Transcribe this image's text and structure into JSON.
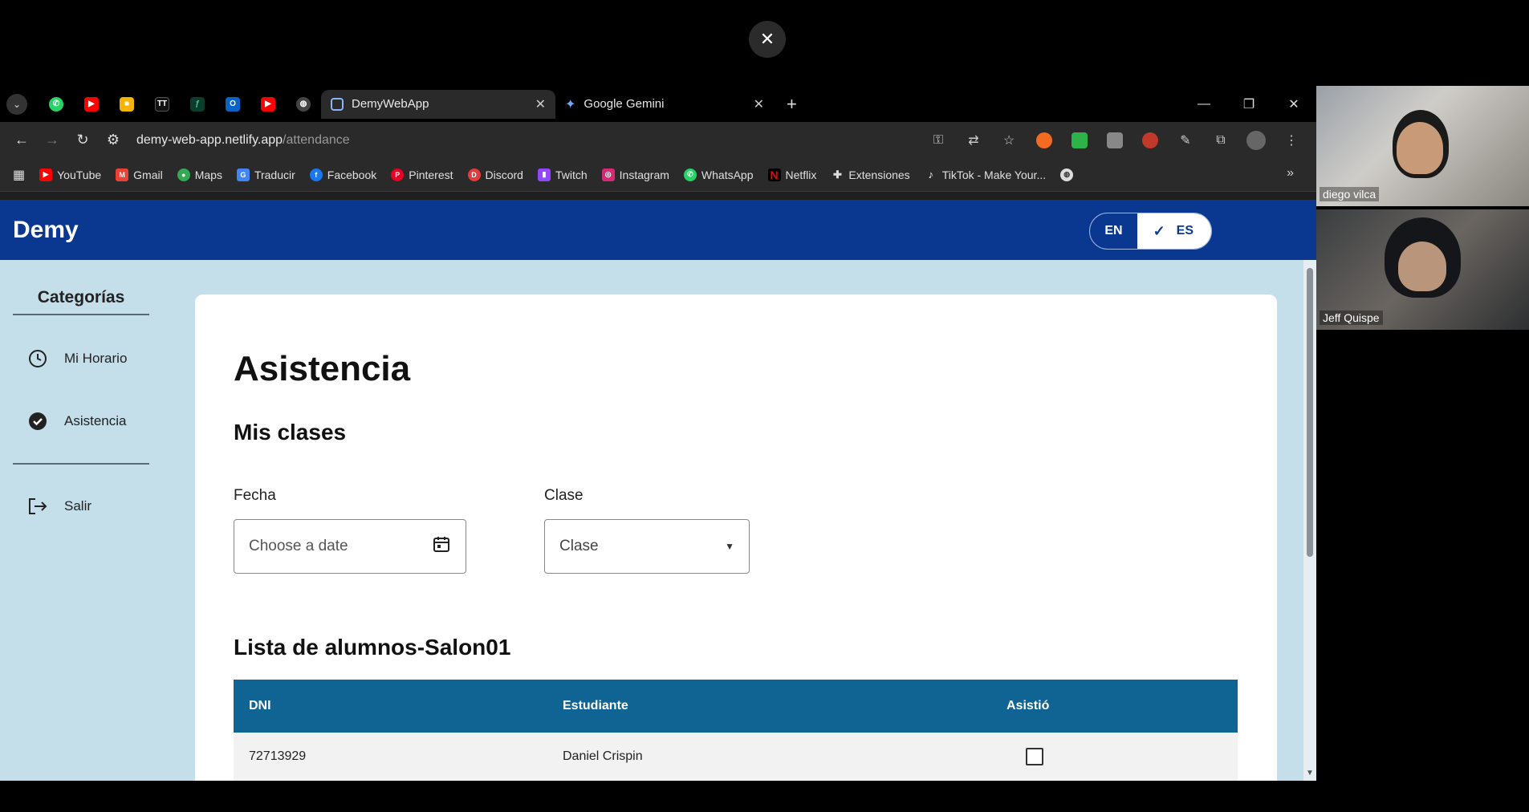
{
  "overlay": {
    "close_icon": "close-icon"
  },
  "browser": {
    "tabs": [
      {
        "label": "DemyWebApp",
        "active": true
      },
      {
        "label": "Google Gemini",
        "active": false
      }
    ],
    "url": {
      "host": "demy-web-app.netlify.app",
      "path": "/attendance"
    },
    "bookmarks": [
      "YouTube",
      "Gmail",
      "Maps",
      "Traducir",
      "Facebook",
      "Pinterest",
      "Discord",
      "Twitch",
      "Instagram",
      "WhatsApp",
      "Netflix",
      "Extensiones",
      "TikTok - Make Your..."
    ]
  },
  "app": {
    "brand": "Demy",
    "lang": {
      "en": "EN",
      "es": "ES",
      "selected": "ES"
    },
    "sidebar": {
      "title": "Categorías",
      "items": [
        {
          "label": "Mi Horario",
          "icon": "clock-icon"
        },
        {
          "label": "Asistencia",
          "icon": "check-circle-icon"
        },
        {
          "label": "Salir",
          "icon": "logout-icon"
        }
      ]
    },
    "main": {
      "title": "Asistencia",
      "subtitle": "Mis clases",
      "date_label": "Fecha",
      "date_placeholder": "Choose a date",
      "class_label": "Clase",
      "class_value": "Clase",
      "list_title": "Lista de alumnos-Salon01",
      "table": {
        "headers": [
          "DNI",
          "Estudiante",
          "Asistió"
        ],
        "rows": [
          {
            "dni": "72713929",
            "student": "Daniel Crispin",
            "attended": false
          }
        ]
      }
    }
  },
  "participants": [
    {
      "name": "diego vilca"
    },
    {
      "name": "Jeff Quispe"
    }
  ],
  "colors": {
    "appbar": "#0a3891",
    "table_header": "#106493",
    "page_bg": "#c4dfe9"
  }
}
